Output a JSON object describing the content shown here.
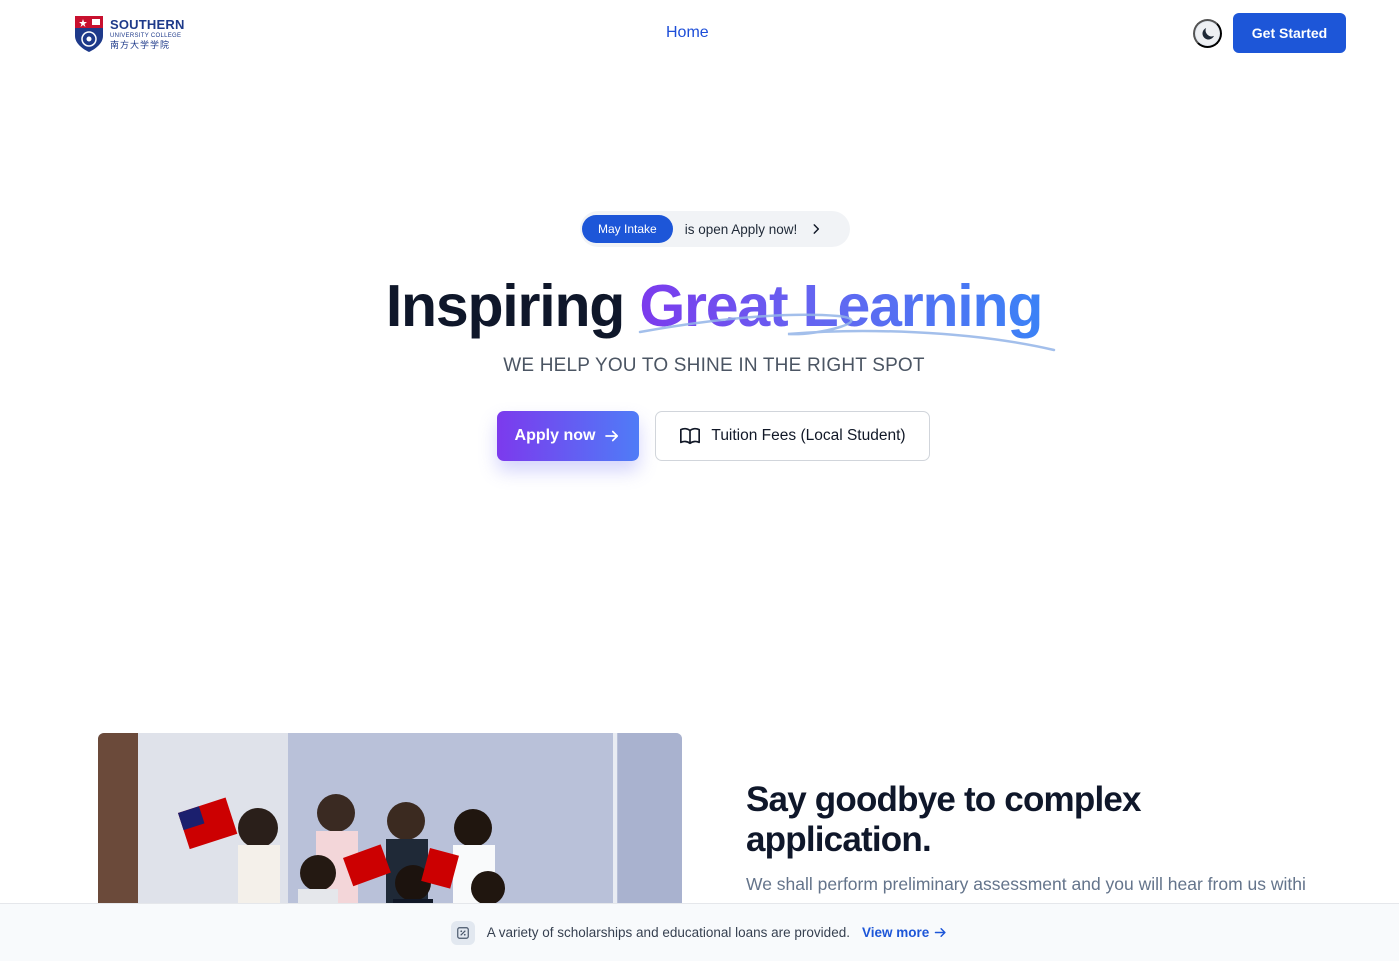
{
  "header": {
    "logo": {
      "name": "SOUTHERN",
      "subtitle": "UNIVERSITY COLLEGE",
      "chinese": "南方大学学院"
    },
    "nav": {
      "home": "Home"
    },
    "theme_toggle_icon": "moon-icon",
    "cta": "Get Started"
  },
  "hero": {
    "intake_badge": "May Intake",
    "intake_text": "is open Apply now!",
    "title_plain": "Inspiring",
    "title_highlight": "Great Learning",
    "subtitle": "WE HELP YOU TO SHINE IN THE RIGHT SPOT",
    "apply_button": "Apply now",
    "fees_button": "Tuition Fees (Local Student)"
  },
  "feature": {
    "title": "Say goodbye to complex application.",
    "description": "We shall perform preliminary assessment and you will hear from us within"
  },
  "banner": {
    "text": "A variety of scholarships and educational loans are provided.",
    "link": "View more"
  },
  "colors": {
    "primary": "#1d56d8",
    "gradient_start": "#7c3aed",
    "gradient_end": "#3b82f6",
    "text_dark": "#0f172a",
    "text_muted": "#64748b"
  }
}
